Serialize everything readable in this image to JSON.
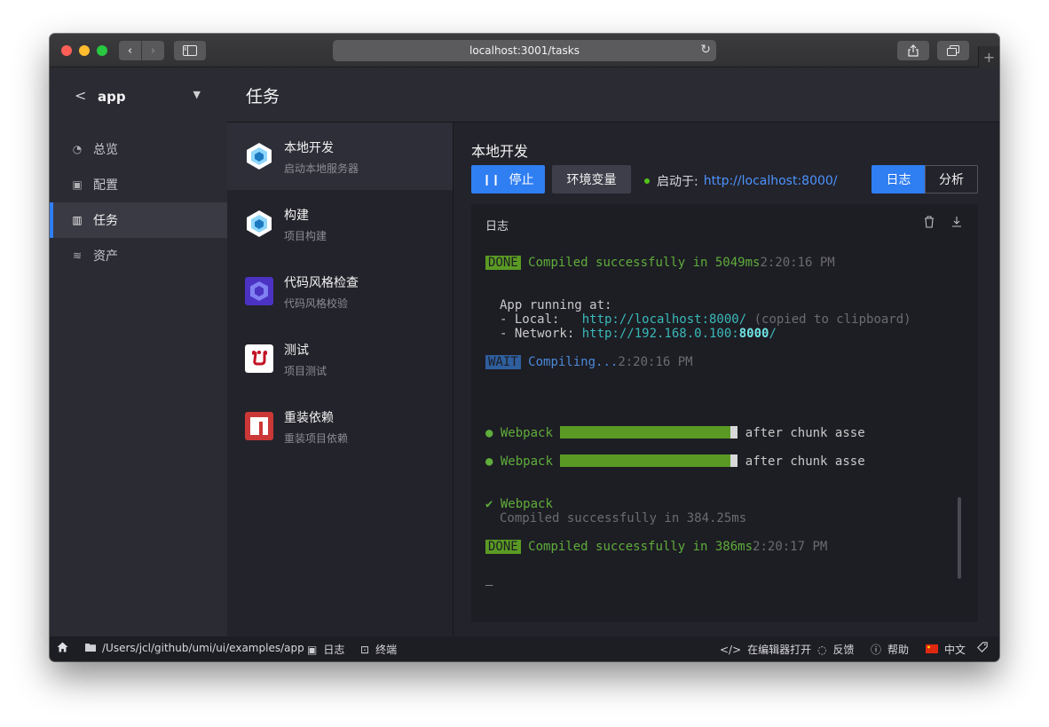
{
  "browser": {
    "url": "localhost:3001/tasks",
    "nav_back": "‹",
    "nav_forward": "›",
    "reload": "↻",
    "new_tab": "+"
  },
  "sidebar": {
    "project": "app",
    "items": [
      {
        "label": "总览",
        "icon": "dashboard-icon",
        "active": false
      },
      {
        "label": "配置",
        "icon": "config-icon",
        "active": false
      },
      {
        "label": "任务",
        "icon": "tasks-icon",
        "active": true
      },
      {
        "label": "资产",
        "icon": "assets-icon",
        "active": false
      }
    ]
  },
  "header": {
    "title": "任务"
  },
  "tasks": [
    {
      "name": "本地开发",
      "desc": "启动本地服务器",
      "icon": "webpack-icon",
      "active": true
    },
    {
      "name": "构建",
      "desc": "项目构建",
      "icon": "webpack-icon",
      "active": false
    },
    {
      "name": "代码风格检查",
      "desc": "代码风格校验",
      "icon": "eslint-icon",
      "active": false
    },
    {
      "name": "测试",
      "desc": "项目测试",
      "icon": "jest-icon",
      "active": false
    },
    {
      "name": "重装依赖",
      "desc": "重装项目依赖",
      "icon": "npm-icon",
      "active": false
    }
  ],
  "detail": {
    "title": "本地开发",
    "stop_label": "停止",
    "env_label": "环境变量",
    "status_prefix": "启动于:",
    "status_url": "http://localhost:8000/",
    "tab_log": "日志",
    "tab_analyze": "分析",
    "log_title": "日志"
  },
  "terminal": {
    "done_badge": "DONE",
    "wait_badge": "WAIT",
    "line1_msg": "Compiled successfully in 5049ms",
    "line1_time": "2:20:16 PM",
    "app_running": "App running at:",
    "local_label": "- Local:   ",
    "local_url": "http://localhost:8000/",
    "local_note": " (copied to clipboard)",
    "network_label": "- Network: ",
    "network_url_pre": "http://192.168.0.100:",
    "network_port": "8000",
    "network_url_post": "/",
    "compiling": "Compiling...",
    "compiling_time": "2:20:16 PM",
    "webpack_label": "Webpack",
    "progress_text": "after chunk asse",
    "progress_1": 0.96,
    "progress_2": 0.96,
    "check": "✔",
    "done_msg2": "Compiled successfully in 384.25ms",
    "line_final_msg": "Compiled successfully in 386ms",
    "line_final_time": "2:20:17 PM",
    "cursor": "_"
  },
  "statusbar": {
    "path": "/Users/jcl/github/umi/ui/examples/app",
    "log": "日志",
    "terminal": "终端",
    "open_editor": "在编辑器打开",
    "feedback": "反馈",
    "help": "帮助",
    "language": "中文"
  }
}
